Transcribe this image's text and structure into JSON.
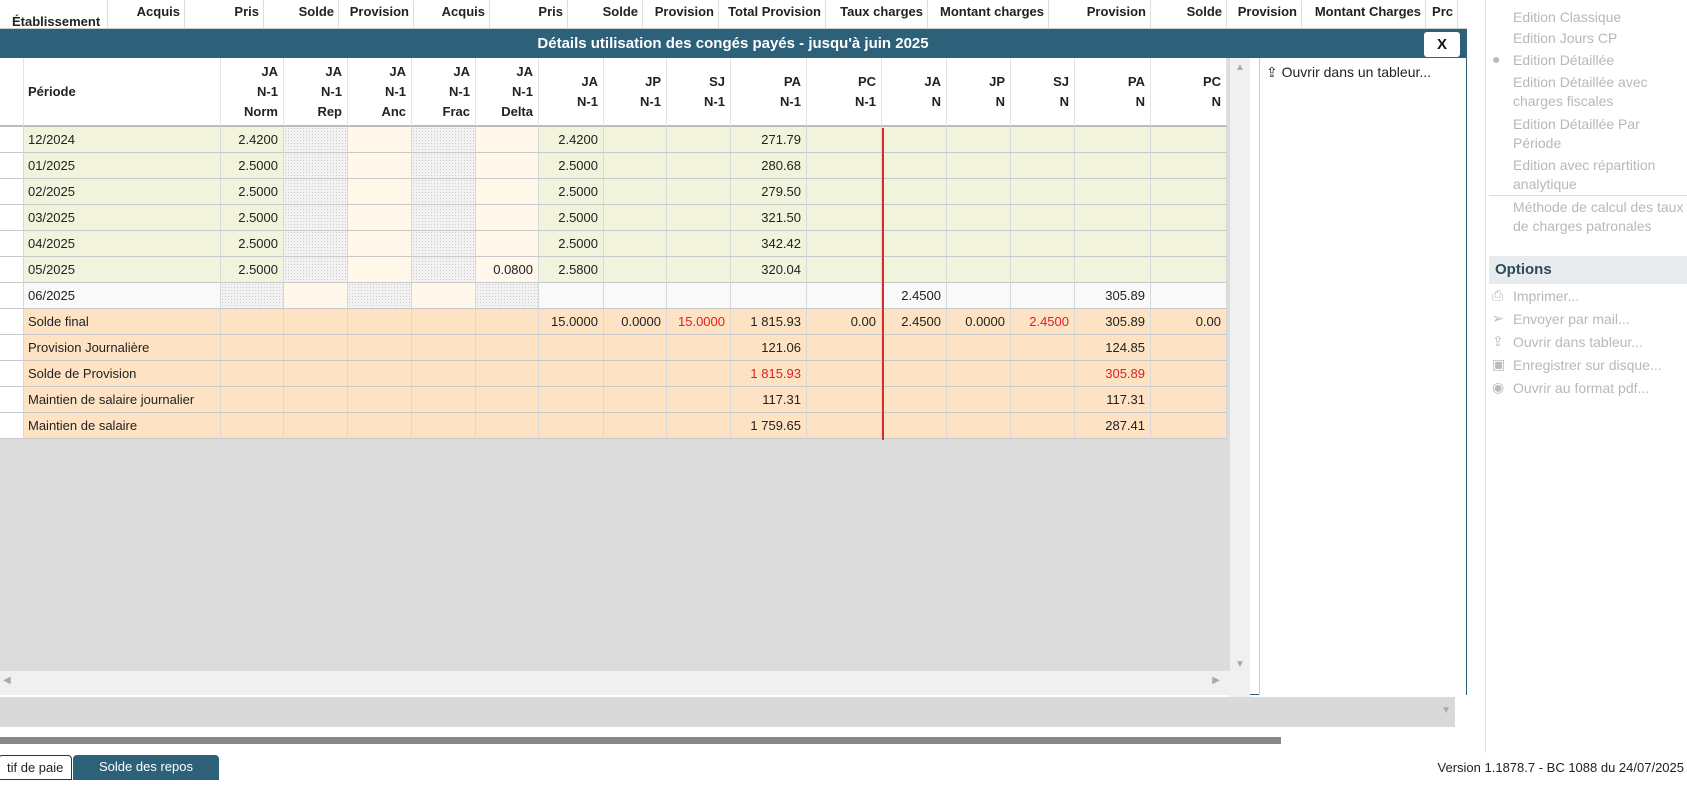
{
  "background_header": [
    "Établissement",
    "Acquis",
    "Pris",
    "Solde",
    "Provision",
    "Acquis",
    "Pris",
    "Solde",
    "Provision",
    "Total Provision",
    "Taux charges",
    "Montant charges",
    "Provision",
    "Solde",
    "Provision",
    "Montant Charges",
    "Prc"
  ],
  "dialog": {
    "title": "Détails utilisation des congés payés - jusqu'à juin 2025",
    "close_label": "X",
    "columns": [
      [
        "Période"
      ],
      [
        "JA",
        "N-1",
        "Norm"
      ],
      [
        "JA",
        "N-1",
        "Rep"
      ],
      [
        "JA",
        "N-1",
        "Anc"
      ],
      [
        "JA",
        "N-1",
        "Frac"
      ],
      [
        "JA",
        "N-1",
        "Delta"
      ],
      [
        "JA",
        "N-1"
      ],
      [
        "JP",
        "N-1"
      ],
      [
        "SJ",
        "N-1"
      ],
      [
        "PA",
        "N-1"
      ],
      [
        "PC",
        "N-1"
      ],
      [
        "JA",
        "N"
      ],
      [
        "JP",
        "N"
      ],
      [
        "SJ",
        "N"
      ],
      [
        "PA",
        "N"
      ],
      [
        "PC",
        "N"
      ]
    ],
    "rows": [
      {
        "type": "month",
        "cells": [
          "12/2024",
          "2.4200",
          "",
          "",
          "",
          "",
          "2.4200",
          "",
          "",
          "271.79",
          "",
          "",
          "",
          "",
          "",
          ""
        ]
      },
      {
        "type": "month",
        "cells": [
          "01/2025",
          "2.5000",
          "",
          "",
          "",
          "",
          "2.5000",
          "",
          "",
          "280.68",
          "",
          "",
          "",
          "",
          "",
          ""
        ]
      },
      {
        "type": "month",
        "cells": [
          "02/2025",
          "2.5000",
          "",
          "",
          "",
          "",
          "2.5000",
          "",
          "",
          "279.50",
          "",
          "",
          "",
          "",
          "",
          ""
        ]
      },
      {
        "type": "month",
        "cells": [
          "03/2025",
          "2.5000",
          "",
          "",
          "",
          "",
          "2.5000",
          "",
          "",
          "321.50",
          "",
          "",
          "",
          "",
          "",
          ""
        ]
      },
      {
        "type": "month",
        "cells": [
          "04/2025",
          "2.5000",
          "",
          "",
          "",
          "",
          "2.5000",
          "",
          "",
          "342.42",
          "",
          "",
          "",
          "",
          "",
          ""
        ]
      },
      {
        "type": "month",
        "cells": [
          "05/2025",
          "2.5000",
          "",
          "",
          "",
          "0.0800",
          "2.5800",
          "",
          "",
          "320.04",
          "",
          "",
          "",
          "",
          "",
          ""
        ]
      },
      {
        "type": "current",
        "cells": [
          "06/2025",
          "",
          "",
          "",
          "",
          "",
          "",
          "",
          "",
          "",
          "",
          "2.4500",
          "",
          "",
          "305.89",
          ""
        ]
      },
      {
        "type": "total",
        "cells": [
          "Solde final",
          "",
          "",
          "",
          "",
          "",
          "15.0000",
          "0.0000",
          "15.0000",
          "1 815.93",
          "0.00",
          "2.4500",
          "0.0000",
          "2.4500",
          "305.89",
          "0.00"
        ],
        "red": [
          8,
          13
        ]
      },
      {
        "type": "total",
        "cells": [
          "Provision Journalière",
          "",
          "",
          "",
          "",
          "",
          "",
          "",
          "",
          "121.06",
          "",
          "",
          "",
          "",
          "124.85",
          ""
        ]
      },
      {
        "type": "total",
        "cells": [
          "Solde de Provision",
          "",
          "",
          "",
          "",
          "",
          "",
          "",
          "",
          "1 815.93",
          "",
          "",
          "",
          "",
          "305.89",
          ""
        ],
        "red": [
          9,
          14
        ]
      },
      {
        "type": "total",
        "cells": [
          "Maintien de salaire journalier",
          "",
          "",
          "",
          "",
          "",
          "",
          "",
          "",
          "117.31",
          "",
          "",
          "",
          "",
          "117.31",
          ""
        ]
      },
      {
        "type": "total",
        "cells": [
          "Maintien de salaire",
          "",
          "",
          "",
          "",
          "",
          "",
          "",
          "",
          "1 759.65",
          "",
          "",
          "",
          "",
          "287.41",
          ""
        ]
      }
    ],
    "side_action": "Ouvrir dans un tableur..."
  },
  "colors": {
    "month": "#f1f3dd",
    "current": "#f9f9f9",
    "total": "#fde3c3",
    "accent": "#2d6179",
    "red": "#e02020"
  },
  "right_panel": {
    "editions": [
      "Edition Classique",
      "Edition Jours CP",
      "Edition Détaillée",
      "Edition Détaillée avec charges fiscales",
      "Edition Détaillée Par Période",
      "Edition avec répartition analytique"
    ],
    "method": "Méthode de calcul des taux de charges patronales",
    "options_title": "Options",
    "options": [
      "Imprimer...",
      "Envoyer par mail...",
      "Ouvrir dans tableur...",
      "Enregistrer sur disque...",
      "Ouvrir au format pdf..."
    ]
  },
  "tabs": [
    "tif de paie",
    "Solde des repos"
  ],
  "version": "Version 1.1878.7 - BC 1088 du 24/07/2025"
}
